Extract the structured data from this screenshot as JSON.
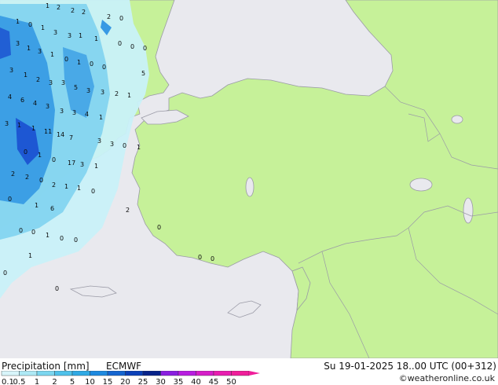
{
  "legend": {
    "title": "Precipitation [mm]",
    "model": "ECMWF",
    "datetime": "Su 19-01-2025 18..00 UTC (00+312)",
    "credit": "©weatheronline.co.uk",
    "scale_labels": [
      "0.1",
      "0.5",
      "1",
      "2",
      "5",
      "10",
      "15",
      "20",
      "25",
      "30",
      "35",
      "40",
      "45",
      "50"
    ],
    "scale_colors": [
      "#d8f5fa",
      "#aee9f5",
      "#7cd6ef",
      "#4fc1ea",
      "#30a9e4",
      "#1e8ae0",
      "#1565d0",
      "#0b40b8",
      "#06228a",
      "#8a1ee0",
      "#b81ee0",
      "#d61ec8",
      "#e81eb0",
      "#f01e9a"
    ]
  },
  "colors": {
    "sea": "#e9e9ee",
    "land": "#c6f199",
    "border": "#9a9aa6",
    "precip_light": "#c9f1f8",
    "precip_mid": "#7fd3ef",
    "precip_heavy": "#2f95e3",
    "precip_max": "#1a4fd0"
  },
  "map_labels": [
    "1",
    "2",
    "2",
    "2",
    "1",
    "0",
    "1",
    "3",
    "3",
    "1",
    "1",
    "2",
    "0",
    "0",
    "0",
    "0",
    "3",
    "1",
    "3",
    "1",
    "0",
    "1",
    "0",
    "0",
    "3",
    "1",
    "2",
    "3",
    "3",
    "5",
    "3",
    "3",
    "2",
    "1",
    "5",
    "4",
    "6",
    "4",
    "3",
    "3",
    "3",
    "4",
    "1",
    "3",
    "1",
    "1",
    "11",
    "14",
    "7",
    "3",
    "3",
    "0",
    "1",
    "0",
    "1",
    "0",
    "17",
    "3",
    "1",
    "2",
    "2",
    "0",
    "2",
    "1",
    "1",
    "0",
    "0",
    "1",
    "6",
    "2",
    "0",
    "0",
    "1",
    "0",
    "0",
    "0",
    "1",
    "0",
    "0",
    "0",
    "0",
    "0",
    "0"
  ]
}
